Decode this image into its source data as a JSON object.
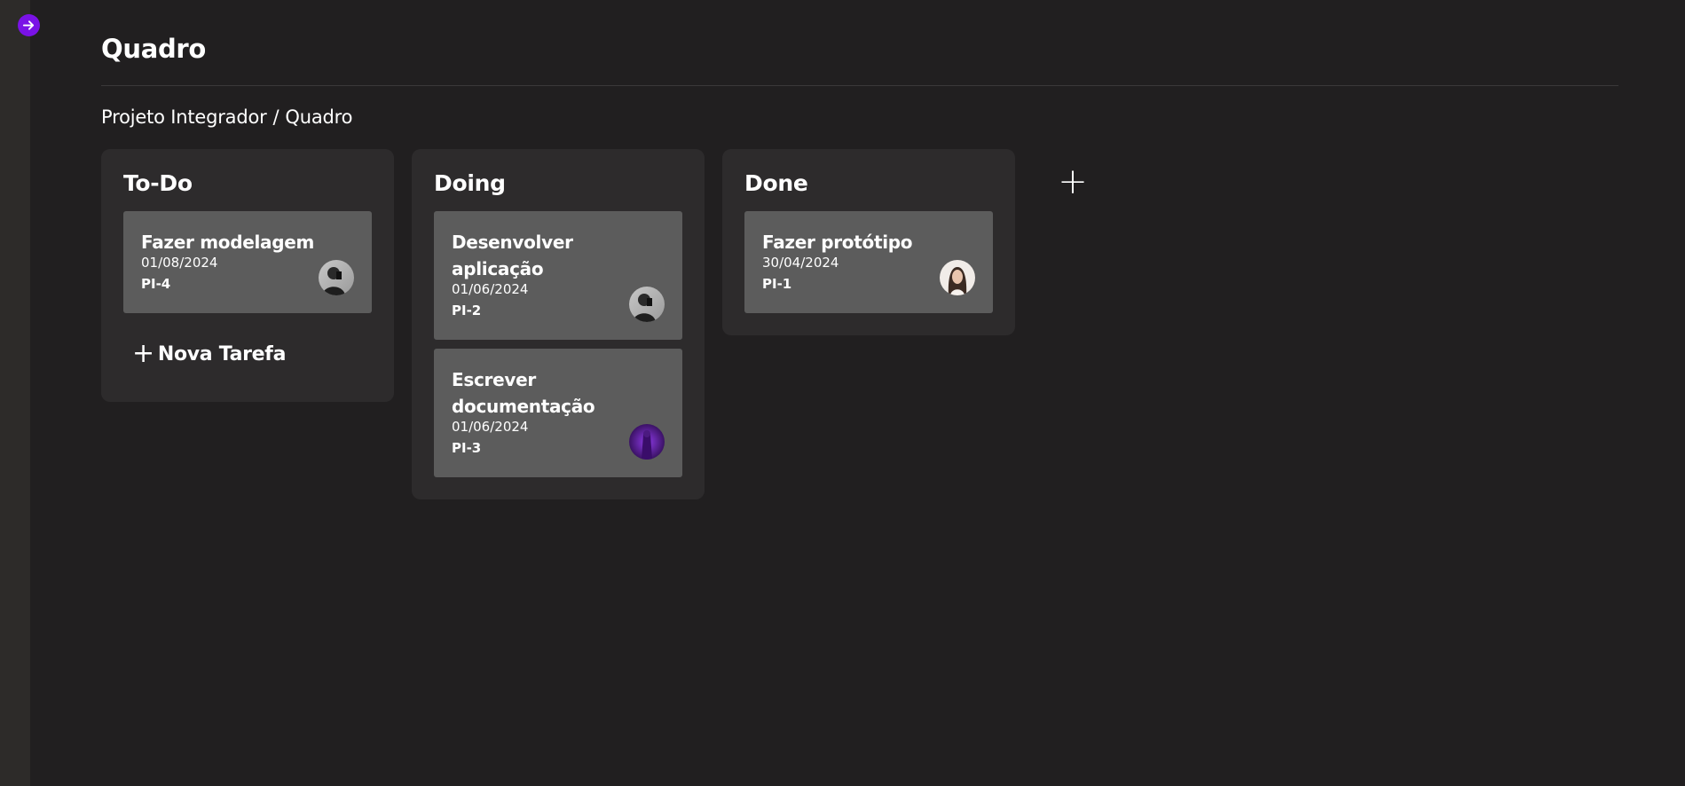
{
  "page": {
    "title": "Quadro"
  },
  "breadcrumb": {
    "project": "Projeto Integrador",
    "separator": "/",
    "current": "Quadro"
  },
  "sidebar": {
    "toggle_icon": "arrow-right-icon",
    "accent": "#7a12e6"
  },
  "board": {
    "add_column_label": "+",
    "columns": [
      {
        "title": "To-Do",
        "cards": [
          {
            "title": "Fazer modelagem",
            "date": "01/08/2024",
            "key": "PI-4",
            "avatar": "user-avatar-dark"
          }
        ],
        "new_task_label": "Nova Tarefa"
      },
      {
        "title": "Doing",
        "cards": [
          {
            "title": "Desenvolver aplicação",
            "date": "01/06/2024",
            "key": "PI-2",
            "avatar": "user-avatar-dark"
          },
          {
            "title": "Escrever documentação",
            "date": "01/06/2024",
            "key": "PI-3",
            "avatar": "user-avatar-purple"
          }
        ]
      },
      {
        "title": "Done",
        "cards": [
          {
            "title": "Fazer protótipo",
            "date": "30/04/2024",
            "key": "PI-1",
            "avatar": "user-avatar-light"
          }
        ]
      }
    ]
  }
}
